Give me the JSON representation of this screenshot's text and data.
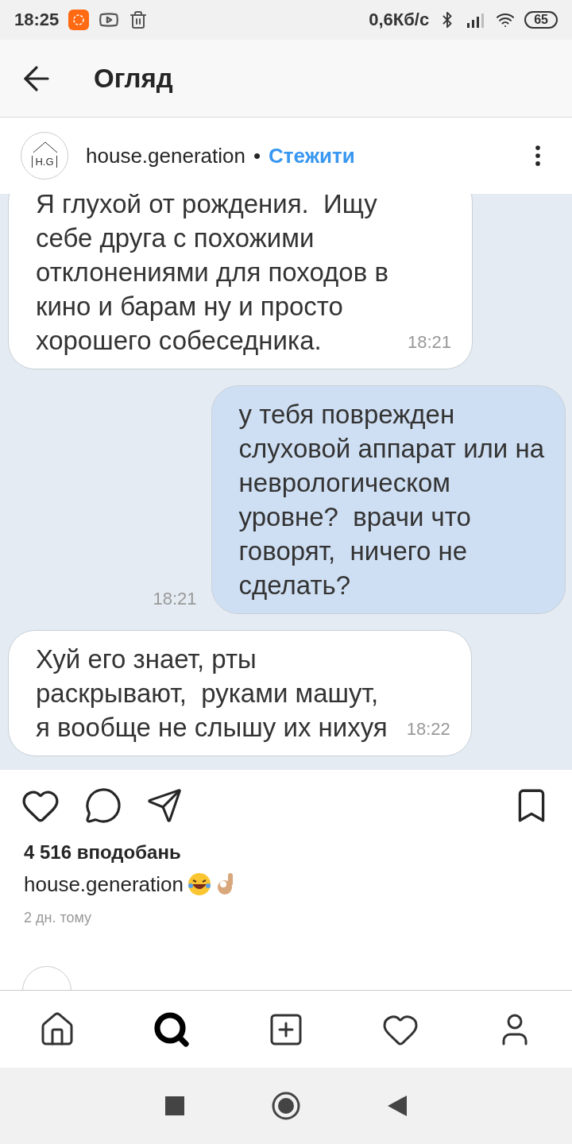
{
  "status_bar": {
    "time": "18:25",
    "speed": "0,6Кб/с",
    "battery": "65"
  },
  "header": {
    "title": "Огляд"
  },
  "post": {
    "avatar_text": "H.G",
    "username": "house.generation",
    "separator": "•",
    "follow": "Стежити",
    "image": {
      "kind": "chat",
      "messages": [
        {
          "kind": "incoming",
          "text": "Я глухой от рождения.  Ищу\nсебе друга с похожими\nотклонениями для походов в\nкино и барам ну и просто\nхорошего собеседника.",
          "time": "18:21"
        },
        {
          "kind": "outgoing",
          "text": "у тебя поврежден\nслуховой аппарат или на\nневрологическом\nуровне?  врачи что\nговорят,  ничего не\nсделать?",
          "time": "18:21"
        },
        {
          "kind": "incoming",
          "text": "Хуй его знает, рты\nраскрывают,  руками машут,\nя вообще не слышу их нихуя",
          "time": "18:22"
        }
      ]
    },
    "liked": false,
    "saved": false,
    "likes": "4 516 вподобань",
    "caption_user": "house.generation",
    "time_ago": "2 дн. тому"
  },
  "bottom_nav": [
    {
      "selected": false
    },
    {
      "selected": true
    },
    {
      "selected": false
    },
    {
      "selected": false
    },
    {
      "selected": false
    }
  ]
}
